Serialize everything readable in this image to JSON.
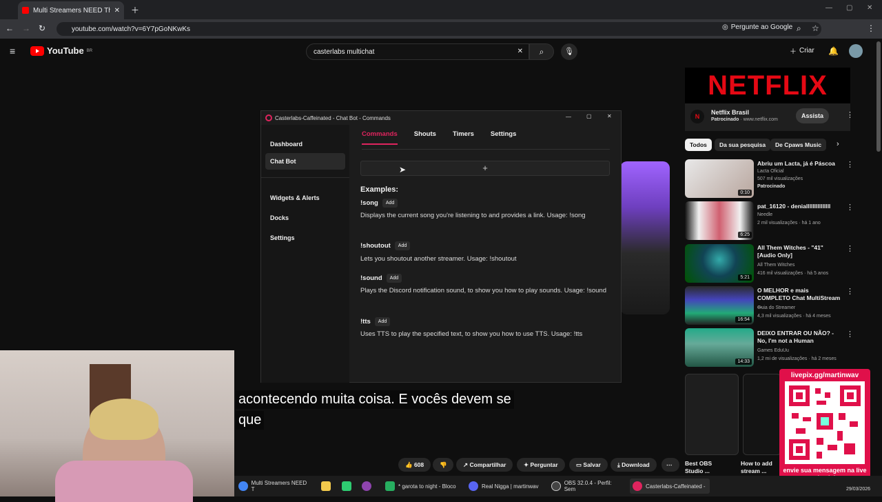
{
  "browser": {
    "tab_title": "Multi Streamers NEED This Free",
    "url": "youtube.com/watch?v=6Y7pGoNKwKs",
    "ask_google": "Pergunte ao Google"
  },
  "youtube": {
    "logo_text": "YouTube",
    "region": "BR",
    "search_value": "casterlabs multichat",
    "create_label": "Criar"
  },
  "app": {
    "title": "Casterlabs-Caffeinated - Chat Bot - Commands",
    "sidebar": [
      {
        "label": "Dashboard"
      },
      {
        "label": "Chat Bot"
      },
      {
        "label": "Widgets & Alerts"
      },
      {
        "label": "Docks"
      },
      {
        "label": "Settings"
      }
    ],
    "tabs": [
      {
        "label": "Commands"
      },
      {
        "label": "Shouts"
      },
      {
        "label": "Timers"
      },
      {
        "label": "Settings"
      }
    ],
    "add_symbol": "+",
    "examples_heading": "Examples:",
    "add_label": "Add",
    "examples": [
      {
        "cmd": "!song",
        "desc": "Displays the current song you're listening to and provides a link. Usage: !song"
      },
      {
        "cmd": "!shoutout",
        "desc": "Lets you shoutout another streamer. Usage: !shoutout"
      },
      {
        "cmd": "!sound",
        "desc": "Plays the Discord notification sound, to show you how to play sounds. Usage: !sound"
      },
      {
        "cmd": "!tts",
        "desc": "Uses TTS to play the specified text, to show you how to use TTS. Usage: !tts"
      }
    ]
  },
  "ad": {
    "brand": "NETFLIX",
    "channel": "Netflix Brasil",
    "sponsored": "Patrocinado",
    "domain": "www.netflix.com",
    "cta": "Assista"
  },
  "chips": [
    "Todos",
    "Da sua pesquisa",
    "De Cpaws Music"
  ],
  "recs": [
    {
      "title": "Abriu um Lacta, já é Páscoa",
      "channel": "Lacta Oficial",
      "meta": "507 mil visualizações",
      "extra": "Patrocinado",
      "dur": "0:10"
    },
    {
      "title": "pat_16120 - denialllllllllllllll",
      "channel": "Needle",
      "meta": "2 mil visualizações · há 1 ano",
      "extra": "",
      "dur": "6:25"
    },
    {
      "title": "All Them Witches - \"41\" [Audio Only]",
      "channel": "All Them Witches",
      "meta": "416 mil visualizações · há 5 anos",
      "extra": "",
      "dur": "5:21"
    },
    {
      "title": "O MELHOR e mais COMPLETO Chat MultiStream ...",
      "channel": "Guia do Streamer",
      "meta": "4,3 mil visualizações · há 4 meses",
      "extra": "",
      "dur": "16:54"
    },
    {
      "title": "DEIXO ENTRAR OU NÃO? - No, I'm not a Human",
      "channel": "Games EduUu",
      "meta": "1,2 mi de visualizações · há 2 meses",
      "extra": "",
      "dur": "14:33"
    }
  ],
  "bottom_recs": [
    "Best OBS Studio ...",
    "How to add stream ..."
  ],
  "subtitles": [
    "acontecendo muita coisa.  E vocês devem se",
    "que"
  ],
  "actions": {
    "likes": "608",
    "share": "Compartilhar",
    "ask": "Perguntar",
    "save": "Salvar",
    "download": "Download"
  },
  "qr": {
    "top": "livepix.gg/martinwav",
    "bottom": "envie sua mensagem na live via pix!"
  },
  "taskbar": [
    {
      "label": "Multi Streamers NEED T",
      "color": "#4285f4"
    },
    {
      "label": "",
      "color": "#f2c94c"
    },
    {
      "label": "",
      "color": "#2ecc71"
    },
    {
      "label": "",
      "color": "#8e44ad"
    },
    {
      "label": "* garota to night - Bloco",
      "color": "#27ae60"
    },
    {
      "label": "Real Nigga | martinwav",
      "color": "#5865f2"
    },
    {
      "label": "OBS 32.0.4 - Perfil: Sem",
      "color": "#444"
    },
    {
      "label": "Casterlabs-Caffeinated -",
      "color": "#e0245e"
    }
  ],
  "clock": {
    "date": "29/03/2026"
  }
}
